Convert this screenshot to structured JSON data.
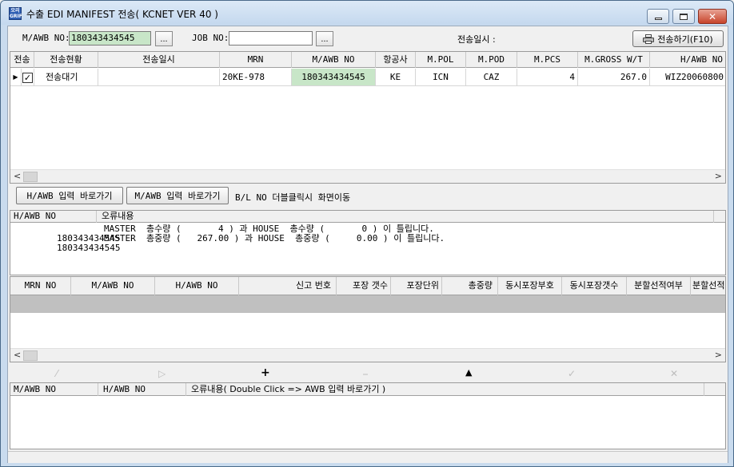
{
  "window": {
    "title": "수출 EDI MANIFEST 전송( KCNET VER 40 )",
    "icon_text": "오리 GRIF"
  },
  "toolbar": {
    "mawb_label": "M/AWB NO:",
    "mawb_value": "180343434545",
    "dots": "...",
    "job_label": "JOB NO:",
    "job_value": "",
    "send_date_label": "전송일시 :",
    "send_button": "전송하기(F10)"
  },
  "master_grid": {
    "headers": [
      "전송",
      "전송현황",
      "전송일시",
      "MRN",
      "M/AWB NO",
      "항공사",
      "M.POL",
      "M.POD",
      "M.PCS",
      "M.GROSS W/T",
      "H/AWB NO"
    ],
    "rows": [
      {
        "checked": true,
        "status": "전송대기",
        "send_time": "",
        "mrn": "20KE-978",
        "mawb": "180343434545",
        "airline": "KE",
        "pol": "ICN",
        "pod": "CAZ",
        "pcs": "4",
        "gross": "267.0",
        "hawb": "WIZ20060800"
      }
    ]
  },
  "buttons": {
    "hawb_goto": "H/AWB 입력 바로가기",
    "mawb_goto": "M/AWB 입력 바로가기",
    "hint": "B/L NO 더블클릭시 화면이동"
  },
  "error_grid": {
    "headers": [
      "H/AWB NO",
      "오류내용"
    ],
    "rows": [
      {
        "hawb": "180343434545",
        "msg": "MASTER  총수량 (       4 ) 과 HOUSE  총수량 (       0 ) 이 틀립니다."
      },
      {
        "hawb": "180343434545",
        "msg": "MASTER  총중량 (   267.00 ) 과 HOUSE  총중량 (     0.00 ) 이 틀립니다."
      }
    ]
  },
  "house_grid": {
    "headers": [
      "MRN NO",
      "M/AWB NO",
      "H/AWB NO",
      "신고 번호",
      "포장 갯수",
      "포장단위",
      "총중량",
      "동시포장부호",
      "동시포장갯수",
      "분할선적여부",
      "분할선적"
    ]
  },
  "nav": {
    "icons": [
      "first-icon",
      "prev-icon",
      "add-icon",
      "delete-icon",
      "up-icon",
      "save-icon",
      "cancel-icon"
    ]
  },
  "bottom_grid": {
    "headers": [
      "M/AWB NO",
      "H/AWB NO",
      "오류내용( Double Click => AWB 입력 바로가기 )"
    ]
  },
  "colors": {
    "highlight_green": "#c8e6c8",
    "selected_row_gray": "#c0c0c0",
    "frame_blue": "#c9dbee"
  }
}
